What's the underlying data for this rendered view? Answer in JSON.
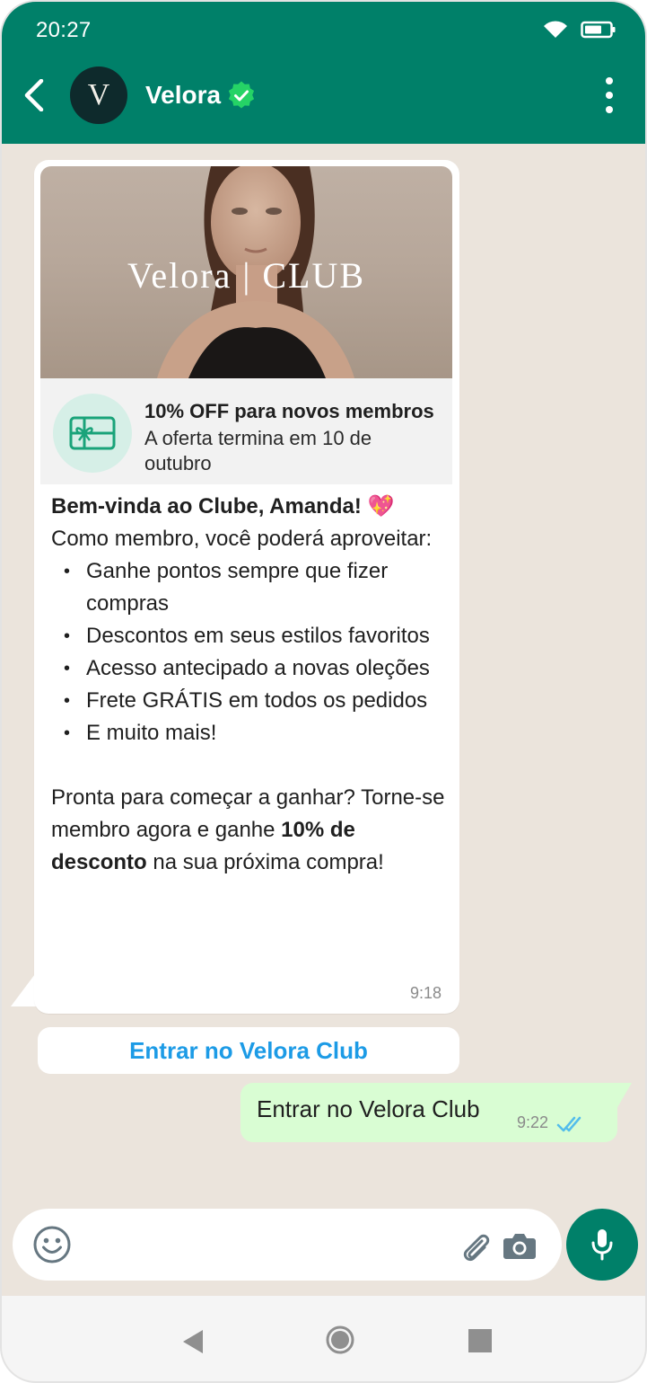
{
  "status_bar": {
    "time": "20:27"
  },
  "header": {
    "contact_name": "Velora",
    "avatar_letter": "V",
    "icons": [
      "back-arrow-icon",
      "verified-badge-icon",
      "more-vert-icon"
    ],
    "color": "#008069"
  },
  "incoming_message": {
    "hero_logo": "Velora | CLUB",
    "offer": {
      "title": "10% OFF para novos membros",
      "subtitle": "A oferta termina em 10 de outubro",
      "icon": "gift-card-icon"
    },
    "greeting": "Bem-vinda ao Clube, Amanda! 💖",
    "intro": "Como membro, você poderá aproveitar:",
    "benefits": [
      "Ganhe pontos sempre que fizer compras",
      "Descontos em seus estilos favoritos",
      "Acesso antecipado a novas oleções",
      "Frete GRÁTIS em todos os pedidos",
      "E muito mais!"
    ],
    "closing_part1": "Pronta para começar a ganhar? Torne-se membro agora e ganhe ",
    "closing_bold": "10% de desconto",
    "closing_part2": " na sua próxima compra!",
    "time": "9:18"
  },
  "cta_button": {
    "label": "Entrar no Velora Club",
    "color": "#1c9be6"
  },
  "outgoing_message": {
    "text": "Entrar no Velora Club",
    "time": "9:22",
    "status": "read"
  },
  "composer": {
    "placeholder": "",
    "icons": [
      "emoji-icon",
      "paperclip-icon",
      "camera-icon",
      "microphone-icon"
    ]
  },
  "nav_bar": {
    "icons": [
      "nav-back-icon",
      "nav-home-icon",
      "nav-recents-icon"
    ]
  }
}
